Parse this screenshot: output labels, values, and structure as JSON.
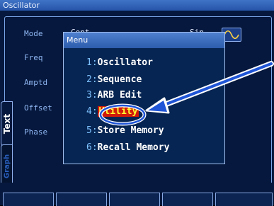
{
  "titlebar": {
    "title": "Oscillator"
  },
  "params": {
    "mode": "Mode",
    "freq": "Freq",
    "amptd": "Amptd",
    "offset": "Offset",
    "phase": "Phase"
  },
  "mode_value": "Cont",
  "mode_extra": "Sin",
  "tabs": {
    "text": "Text",
    "graph": "Graph"
  },
  "menu": {
    "title": "Menu",
    "items": [
      {
        "num": "1:",
        "label": "Oscillator"
      },
      {
        "num": "2:",
        "label": "Sequence"
      },
      {
        "num": "3:",
        "label": "ARB Edit"
      },
      {
        "num": "4:",
        "label": "Utility"
      },
      {
        "num": "5:",
        "label": "Store Memory"
      },
      {
        "num": "6:",
        "label": "Recall Memory"
      }
    ]
  },
  "colors": {
    "highlight_bg": "#d11a0a",
    "highlight_text": "#ffff33",
    "callout": "#1f55d6"
  },
  "icons": [
    "sine-wave-icon",
    "callout-arrow-icon"
  ]
}
